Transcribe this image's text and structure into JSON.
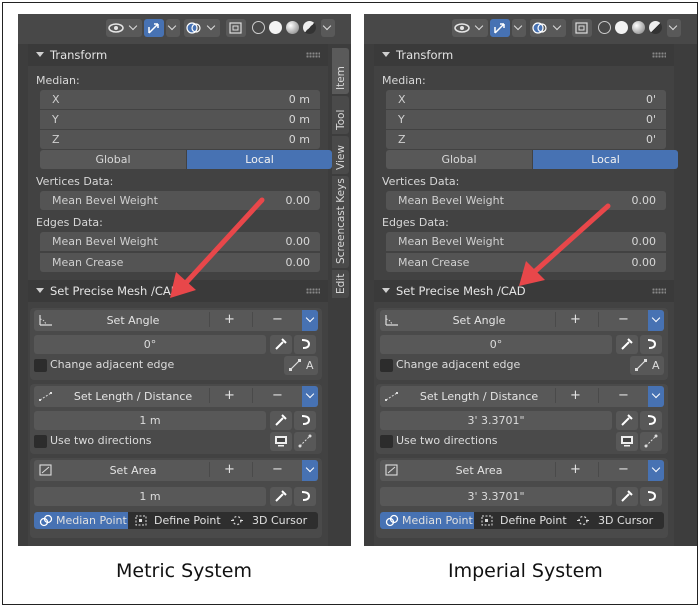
{
  "colors": {
    "accent": "#4772b3",
    "panel": "#3d3d3d",
    "arrow": "#e8474a"
  },
  "panels": [
    {
      "id": "metric",
      "caption": "Metric System",
      "transform": {
        "title": "Transform",
        "median_label": "Median:",
        "x_label": "X",
        "x_value": "0 m",
        "y_label": "Y",
        "y_value": "0 m",
        "z_label": "Z",
        "z_value": "0 m",
        "global_label": "Global",
        "local_label": "Local",
        "vertices_label": "Vertices Data:",
        "v_bevel_label": "Mean Bevel Weight",
        "v_bevel_value": "0.00",
        "edges_label": "Edges Data:",
        "e_bevel_label": "Mean Bevel Weight",
        "e_bevel_value": "0.00",
        "crease_label": "Mean Crease",
        "crease_value": "0.00"
      },
      "cad": {
        "title": "Set Precise Mesh /CAD",
        "angle_label": "Set Angle",
        "angle_value": "0°",
        "change_edge_label": "Change adjacent edge",
        "length_label": "Set Length / Distance",
        "length_value": "1 m",
        "two_dir_label": "Use two directions",
        "area_label": "Set Area",
        "area_value": "1 m",
        "plus": "+",
        "minus": "−",
        "median_point": "Median Point",
        "define_point": "Define Point",
        "cursor_3d": "3D Cursor",
        "a_label": "A"
      },
      "tabs": [
        "Item",
        "Tool",
        "View",
        "Screencast Keys",
        "Edit"
      ]
    },
    {
      "id": "imperial",
      "caption": "Imperial System",
      "transform": {
        "title": "Transform",
        "median_label": "Median:",
        "x_label": "X",
        "x_value": "0'",
        "y_label": "Y",
        "y_value": "0'",
        "z_label": "Z",
        "z_value": "0'",
        "global_label": "Global",
        "local_label": "Local",
        "vertices_label": "Vertices Data:",
        "v_bevel_label": "Mean Bevel Weight",
        "v_bevel_value": "0.00",
        "edges_label": "Edges Data:",
        "e_bevel_label": "Mean Bevel Weight",
        "e_bevel_value": "0.00",
        "crease_label": "Mean Crease",
        "crease_value": "0.00"
      },
      "cad": {
        "title": "Set Precise Mesh /CAD",
        "angle_label": "Set Angle",
        "angle_value": "0°",
        "change_edge_label": "Change adjacent edge",
        "length_label": "Set Length / Distance",
        "length_value": "3' 3.3701\"",
        "two_dir_label": "Use two directions",
        "area_label": "Set Area",
        "area_value": "3' 3.3701\"",
        "plus": "+",
        "minus": "−",
        "median_point": "Median Point",
        "define_point": "Define Point",
        "cursor_3d": "3D Cursor",
        "a_label": "A"
      }
    }
  ]
}
